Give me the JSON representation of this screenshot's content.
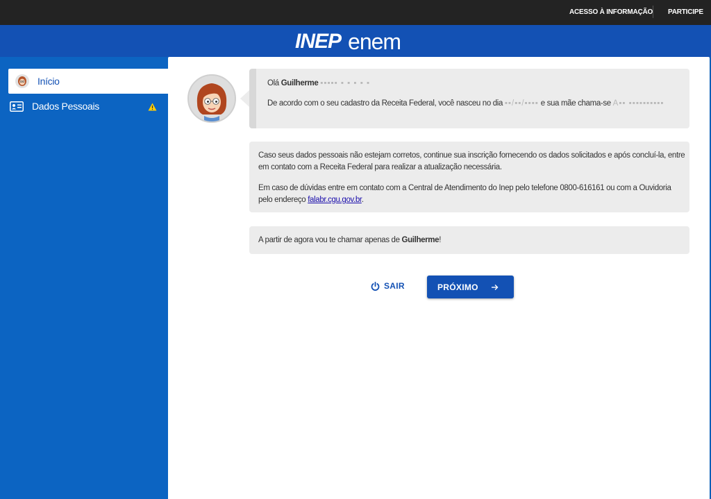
{
  "topbar": {
    "access_info": "ACESSO À INFORMAÇÃO",
    "participate": "PARTICIPE"
  },
  "header": {
    "logo_inep": "INEP",
    "logo_enem": "enem"
  },
  "sidebar": {
    "items": [
      {
        "label": "Início",
        "icon": "avatar-icon",
        "active": true
      },
      {
        "label": "Dados Pessoais",
        "icon": "id-card-icon",
        "warning": true
      }
    ]
  },
  "chat": {
    "greeting_prefix": "Olá ",
    "user_first_name": "Guilherme",
    "greeting_redacted": "▪▪▪▪▪ ▪ ▪ ▪ ▪ ▪",
    "birth_text_1": "De acordo com o seu cadastro da Receita Federal, você nasceu no dia ",
    "birth_redacted": "▪▪/▪▪/▪▪▪▪",
    "birth_text_2": " e sua mãe chama-se ",
    "mother_redacted": "A▪▪ ▪▪▪▪▪▪▪▪▪▪",
    "info_p1_l1": "Caso seus dados pessoais não estejam corretos, continue sua inscrição fornecendo os dados solicitados e após concluí-la, entre",
    "info_p1_l2": "em contato com a Receita Federal para realizar a atualização necessária.",
    "info_p2_l1": "Em caso de dúvidas entre em contato com a Central de Atendimento do Inep pelo telefone 0800-616161 ou com a Ouvidoria",
    "info_p2_l2_prefix": "pelo endereço ",
    "info_link": "falabr.cgu.gov.br",
    "info_p2_l2_suffix": ".",
    "nickname_prefix": "A partir de agora vou te chamar apenas de ",
    "nickname": "Guilherme",
    "nickname_suffix": "!"
  },
  "actions": {
    "exit_label": "SAIR",
    "next_label": "PRÓXIMO"
  },
  "colors": {
    "primary": "#1351b4",
    "sidebar": "#0c64c2",
    "topbar": "#232323",
    "card": "#ececec",
    "warning": "#ffcd07"
  }
}
